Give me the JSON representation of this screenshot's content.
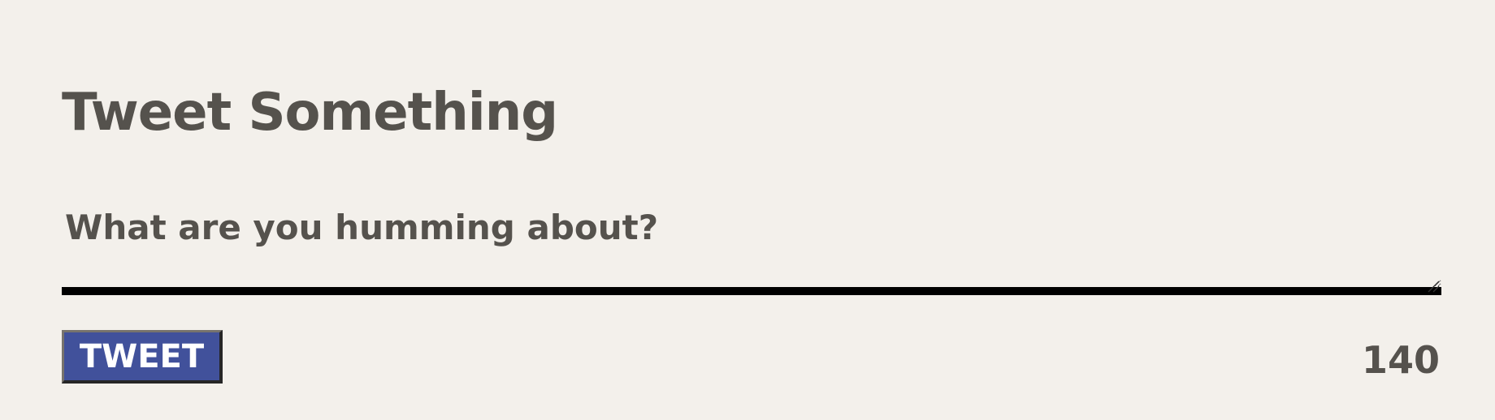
{
  "composer": {
    "title": "Tweet Something",
    "input": {
      "value": "",
      "placeholder": "What are you humming about?"
    },
    "submit_label": "TWEET",
    "remaining_characters": "140"
  },
  "colors": {
    "background": "#f3f0eb",
    "text": "#55524d",
    "button": "#41519b",
    "border": "#000000"
  },
  "icons": {
    "resize_handle": "resize-handle-icon"
  }
}
